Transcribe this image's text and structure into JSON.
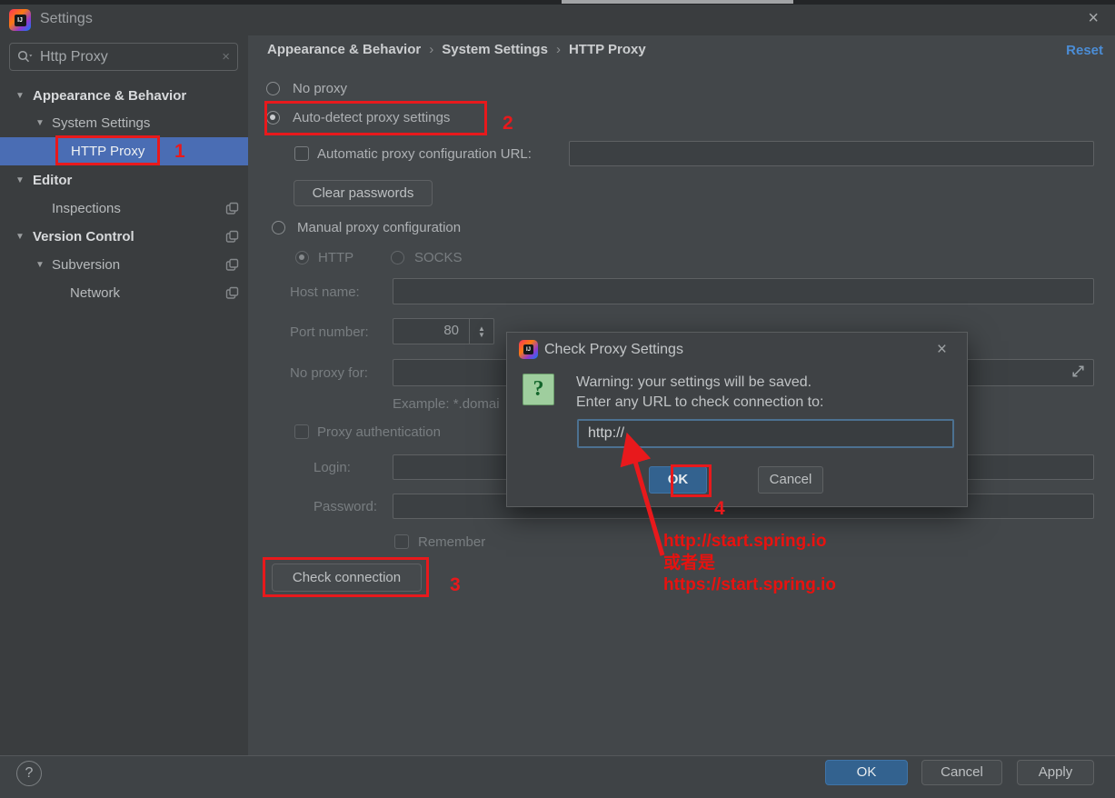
{
  "window": {
    "title": "Settings",
    "close_icon": "×"
  },
  "search": {
    "value": "Http Proxy",
    "clear_icon": "×"
  },
  "sidebar": {
    "items": [
      {
        "label": "Appearance & Behavior"
      },
      {
        "label": "System Settings"
      },
      {
        "label": "HTTP Proxy"
      },
      {
        "label": "Editor"
      },
      {
        "label": "Inspections"
      },
      {
        "label": "Version Control"
      },
      {
        "label": "Subversion"
      },
      {
        "label": "Network"
      }
    ]
  },
  "breadcrumb": {
    "part1": "Appearance & Behavior",
    "part2": "System Settings",
    "part3": "HTTP Proxy",
    "separator": "›",
    "reset_label": "Reset"
  },
  "proxy_form": {
    "no_proxy_label": "No proxy",
    "auto_detect_label": "Auto-detect proxy settings",
    "auto_config_label": "Automatic proxy configuration URL:",
    "auto_config_value": "",
    "clear_passwords_label": "Clear passwords",
    "manual_label": "Manual proxy configuration",
    "http_label": "HTTP",
    "socks_label": "SOCKS",
    "host_label": "Host name:",
    "host_value": "",
    "port_label": "Port number:",
    "port_value": "80",
    "no_proxy_for_label": "No proxy for:",
    "no_proxy_for_value": "",
    "example_text": "Example: *.domai",
    "proxy_auth_label": "Proxy authentication",
    "login_label": "Login:",
    "login_value": "",
    "password_label": "Password:",
    "password_value": "",
    "remember_label": "Remember",
    "check_connection_label": "Check connection"
  },
  "dialog": {
    "title": "Check Proxy Settings",
    "close_icon": "×",
    "question_icon": "?",
    "warning_line1": "Warning: your settings will be saved.",
    "warning_line2": "Enter any URL to check connection to:",
    "url_value": "http://",
    "ok_label": "OK",
    "cancel_label": "Cancel"
  },
  "footer": {
    "help_icon": "?",
    "ok_label": "OK",
    "cancel_label": "Cancel",
    "apply_label": "Apply"
  },
  "annotations": {
    "step1": "1",
    "step2": "2",
    "step3": "3",
    "step4": "4",
    "note_line1": "http://start.spring.io",
    "note_line2": "或者是",
    "note_line3": "https://start.spring.io",
    "accent_color": "#e8191c"
  },
  "colors": {
    "selection_blue": "#4a6db4",
    "primary_button_blue": "#33628f",
    "reset_link_blue": "#4b8dd6",
    "annotation_red": "#e8191c",
    "question_icon_green": "#9fce9e"
  }
}
